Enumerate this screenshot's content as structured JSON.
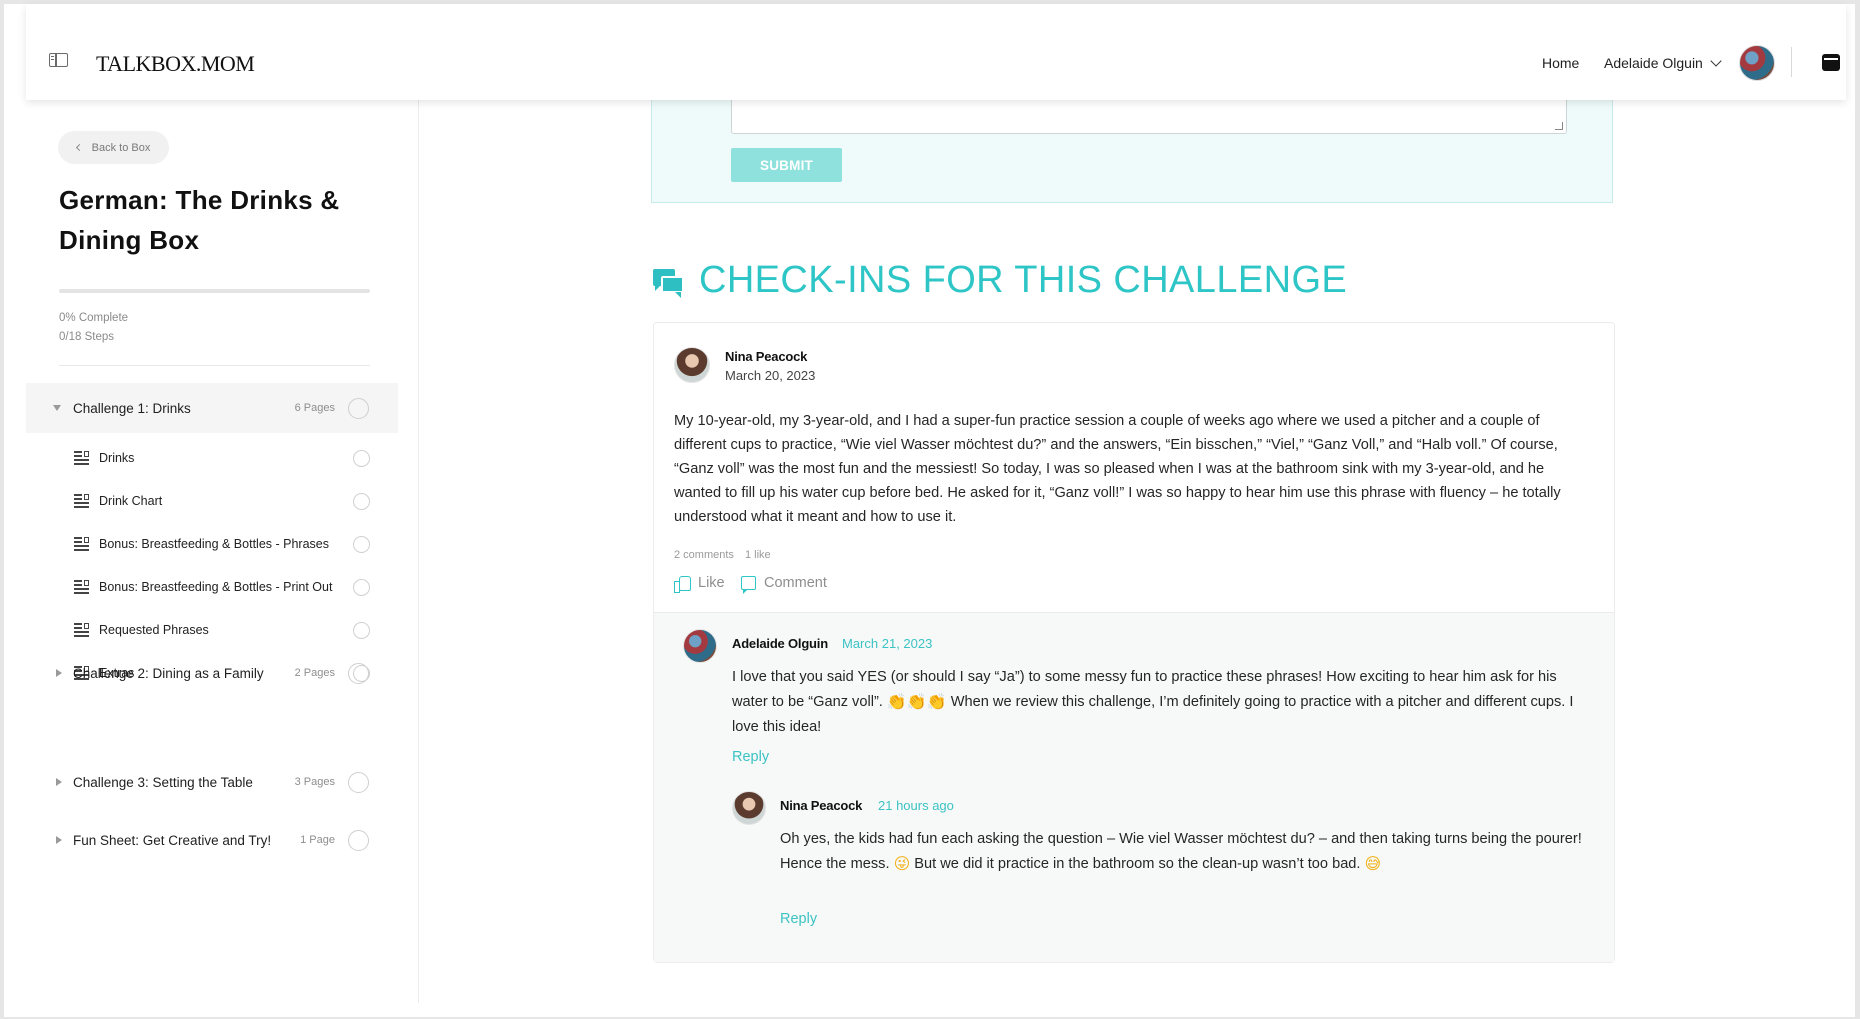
{
  "header": {
    "logo": "TALKBOX.MOM",
    "nav_home": "Home",
    "user_name": "Adelaide Olguin"
  },
  "sidebar": {
    "back_label": "Back to Box",
    "course_title": "German: The Drinks & Dining Box",
    "progress_percent": 0,
    "complete_text": "0% Complete",
    "steps_text": "0/18 Steps",
    "sections": [
      {
        "label": "Challenge 1: Drinks",
        "pages": "6 Pages",
        "expanded": true,
        "lessons": [
          {
            "label": "Drinks"
          },
          {
            "label": "Drink Chart"
          },
          {
            "label": "Bonus: Breastfeeding & Bottles - Phrases"
          },
          {
            "label": "Bonus: Breastfeeding & Bottles - Print Out"
          },
          {
            "label": "Requested Phrases"
          },
          {
            "label": "Extras"
          }
        ]
      },
      {
        "label": "Challenge 2: Dining as a Family",
        "pages": "2 Pages",
        "expanded": false
      },
      {
        "label": "Challenge 3: Setting the Table",
        "pages": "3 Pages",
        "expanded": false
      },
      {
        "label": "Fun Sheet: Get Creative and Try!",
        "pages": "1 Page",
        "expanded": false
      }
    ]
  },
  "form": {
    "submit_label": "SUBMIT"
  },
  "checkins": {
    "title": "CHECK-INS FOR THIS CHALLENGE",
    "post": {
      "author": "Nina Peacock",
      "date": "March 20, 2023",
      "body": "My 10-year-old, my 3-year-old, and I had a super-fun practice session a couple of weeks ago where we used a pitcher and a couple of different cups to practice, “Wie viel Wasser möchtest du?” and the answers, “Ein bisschen,” “Viel,” “Ganz Voll,” and “Halb voll.” Of course, “Ganz voll” was the most fun and the messiest! So today, I was so pleased when I was at the bathroom sink with my 3-year-old, and he wanted to fill up his water cup before bed. He asked for it, “Ganz voll!” I was so happy to hear him use this phrase with fluency – he totally understood what it meant and how to use it.",
      "comments_count": "2 comments",
      "likes_count": "1 like",
      "like_label": "Like",
      "comment_label": "Comment"
    },
    "replies": [
      {
        "author": "Adelaide Olguin",
        "date": "March 21, 2023",
        "body_before": "I love that you said YES (or should I say “Ja”) to some messy fun to practice these phrases! How exciting to hear him ask for his water to be “Ganz voll”. ",
        "emoji": "👏👏👏",
        "body_after": " When we review this challenge, I’m definitely going to practice with a pitcher and different cups. I love this idea!",
        "reply_label": "Reply"
      },
      {
        "author": "Nina Peacock",
        "date": "21 hours ago",
        "body_before": "Oh yes, the kids had fun each asking the question – Wie viel Wasser möchtest du? – and then taking turns being the pourer! Hence the mess. ",
        "emoji": "😜",
        "body_middle": " But we did it practice in the bathroom so the clean-up wasn’t too bad. ",
        "emoji2": "😅",
        "reply_label": "Reply"
      }
    ]
  },
  "colors": {
    "accent": "#2ec5c6",
    "submit_bg": "#8fe1dd",
    "form_bg": "#eefbfa"
  }
}
